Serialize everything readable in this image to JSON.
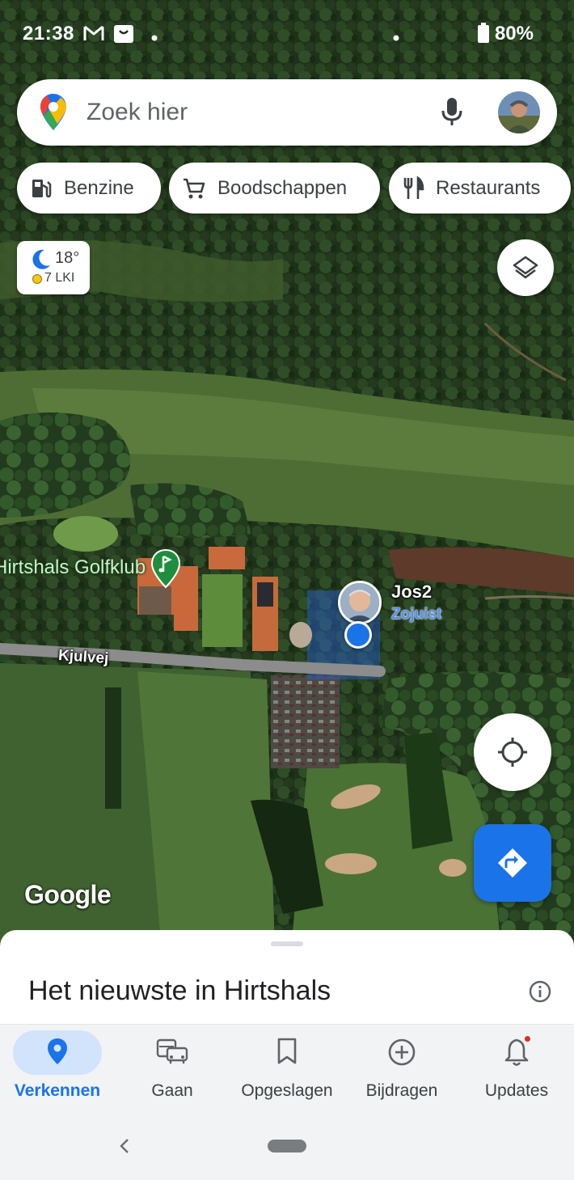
{
  "status_bar": {
    "time": "21:38",
    "battery": "80%",
    "icons": [
      "gmail-icon",
      "shopping-bag-icon",
      "dot-icon",
      "dot-icon",
      "battery-icon"
    ]
  },
  "search": {
    "placeholder": "Zoek hier",
    "icons": [
      "google-maps-logo",
      "microphone-icon",
      "profile-avatar"
    ]
  },
  "chips": [
    {
      "label": "Benzine",
      "icon": "gas-station-icon"
    },
    {
      "label": "Boodschappen",
      "icon": "shopping-cart-icon"
    },
    {
      "label": "Restaurants",
      "icon": "restaurant-icon"
    }
  ],
  "weather": {
    "temperature": "18°",
    "air_quality": "7 LKI",
    "icon": "moon-icon"
  },
  "map": {
    "place_label": "Hirtshals Golfklub",
    "road_label": "Kjulvej",
    "shared_user": {
      "name": "Jos2",
      "status": "Zojuist"
    },
    "attribution": "Google"
  },
  "bottom_sheet": {
    "title": "Het nieuwste in Hirtshals"
  },
  "nav": {
    "items": [
      {
        "label": "Verkennen",
        "icon": "location-pin-icon",
        "active": true
      },
      {
        "label": "Gaan",
        "icon": "commute-icon",
        "active": false
      },
      {
        "label": "Opgeslagen",
        "icon": "bookmark-icon",
        "active": false
      },
      {
        "label": "Bijdragen",
        "icon": "add-circle-icon",
        "active": false
      },
      {
        "label": "Updates",
        "icon": "bell-icon",
        "active": false,
        "badge": true
      }
    ]
  },
  "colors": {
    "accent": "#1a73e8",
    "nav_active_pill": "#d2e3fc"
  }
}
